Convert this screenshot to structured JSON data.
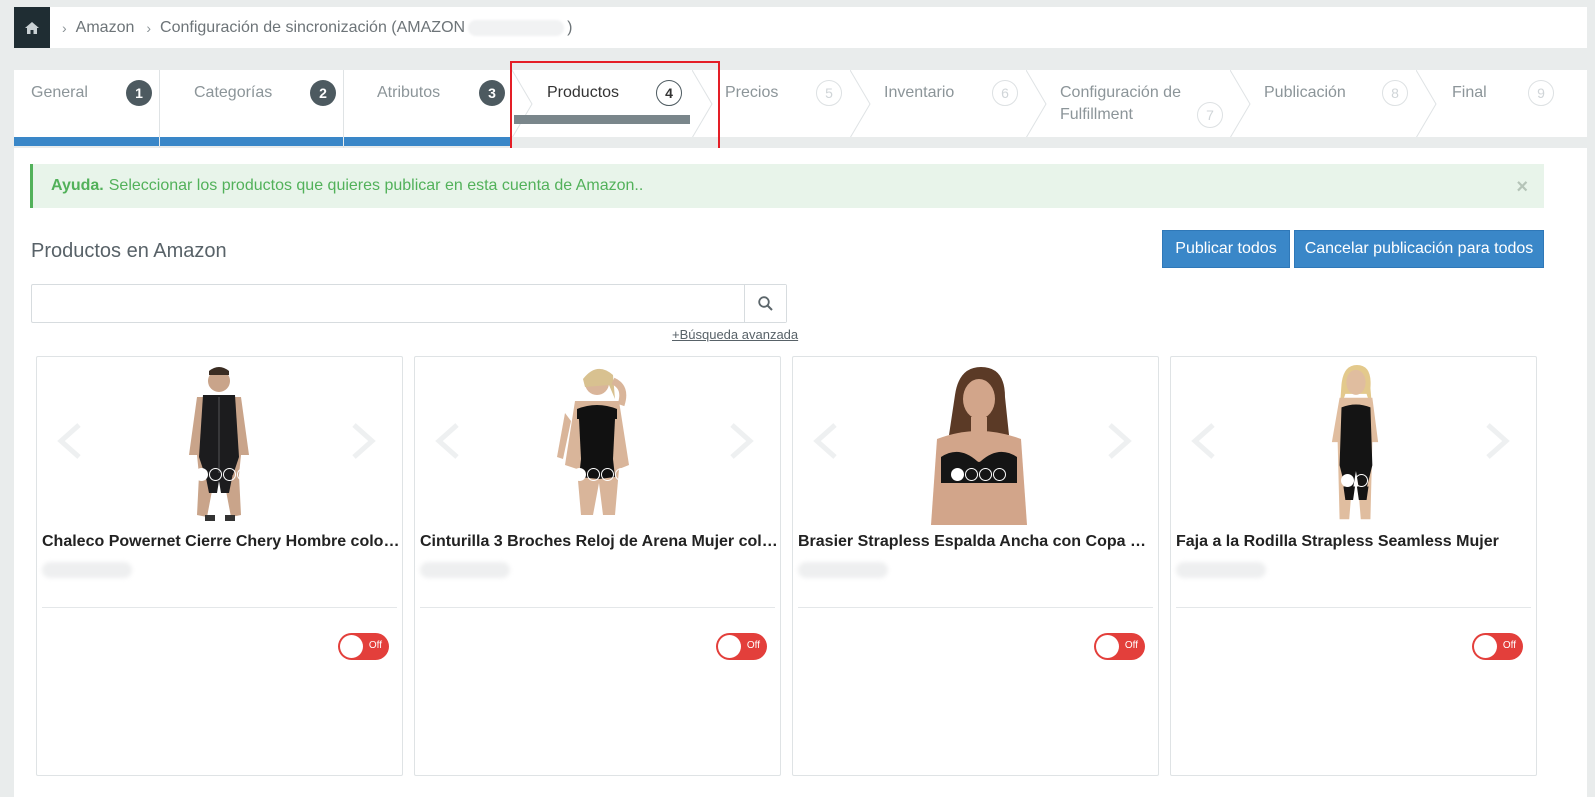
{
  "breadcrumb": {
    "home_icon": "home-icon",
    "items": [
      "Amazon",
      "Configuración de sincronización (AMAZON"
    ],
    "tail": ")"
  },
  "wizard": {
    "steps": [
      {
        "label": "General",
        "number": "1",
        "state": "done"
      },
      {
        "label": "Categorías",
        "number": "2",
        "state": "done"
      },
      {
        "label": "Atributos",
        "number": "3",
        "state": "done"
      },
      {
        "label": "Productos",
        "number": "4",
        "state": "active"
      },
      {
        "label": "Precios",
        "number": "5",
        "state": "todo"
      },
      {
        "label": "Inventario",
        "number": "6",
        "state": "todo"
      },
      {
        "label": "Configuración de Fulfillment",
        "number": "7",
        "state": "todo"
      },
      {
        "label": "Publicación",
        "number": "8",
        "state": "todo"
      },
      {
        "label": "Final",
        "number": "9",
        "state": "todo"
      }
    ],
    "highlight_color": "#e41e26"
  },
  "alert": {
    "strong": "Ayuda.",
    "text": "Seleccionar los productos que quieres publicar en esta cuenta de Amazon..",
    "close": "×"
  },
  "section": {
    "title": "Productos en Amazon",
    "publish_all": "Publicar todos",
    "cancel_all": "Cancelar publicación para todos"
  },
  "search": {
    "placeholder": "",
    "value": "",
    "icon": "search-icon",
    "advanced": "+Búsqueda avanzada"
  },
  "products": [
    {
      "title": "Chaleco Powernet Cierre Chery Hombre color ...",
      "dots": 4,
      "toggle": "Off"
    },
    {
      "title": "Cinturilla 3 Broches Reloj de Arena Mujer colo...",
      "dots": 4,
      "toggle": "Off"
    },
    {
      "title": "Brasier Strapless Espalda Ancha con Copa Pr...",
      "dots": 4,
      "toggle": "Off"
    },
    {
      "title": "Faja a la Rodilla Strapless Seamless Mujer",
      "dots": 2,
      "toggle": "Off"
    }
  ],
  "colors": {
    "primary": "#3a87c8",
    "toggle_off": "#e33f3b",
    "alert_green": "#52b15a",
    "dark": "#1f2d33"
  }
}
